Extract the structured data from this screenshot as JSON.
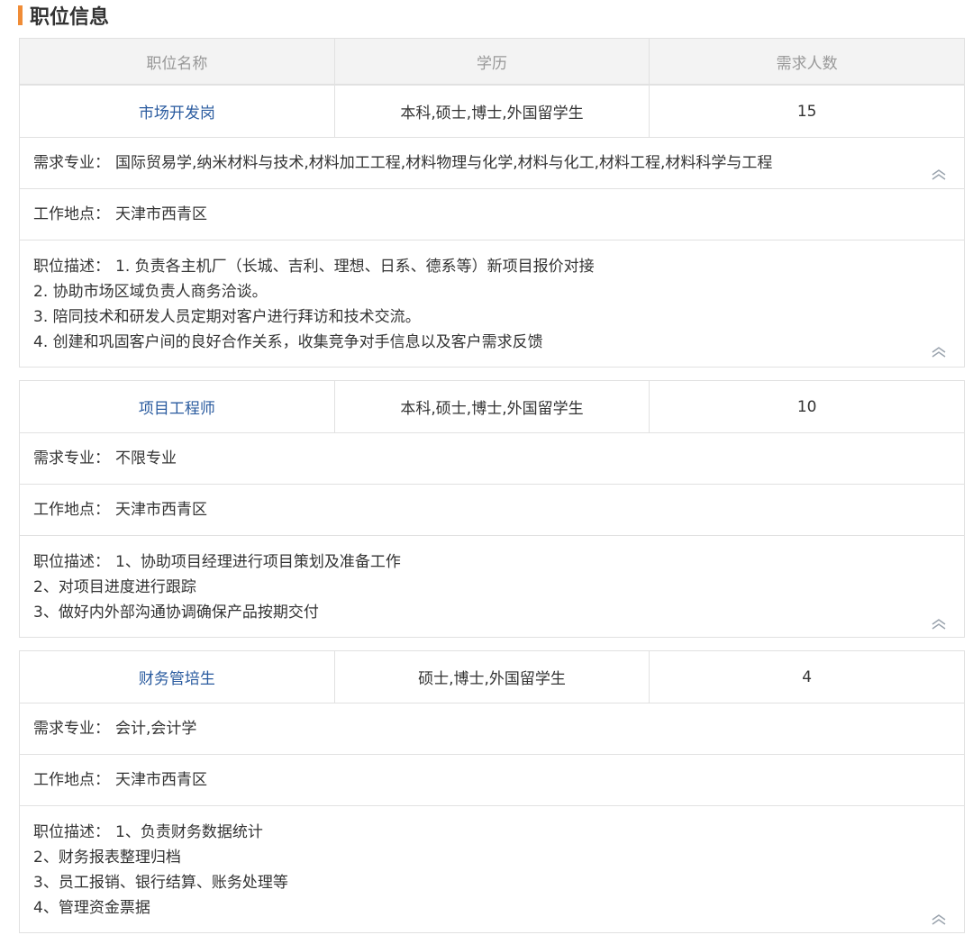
{
  "section": {
    "title": "职位信息"
  },
  "headers": [
    "职位名称",
    "学历",
    "需求人数"
  ],
  "labels": {
    "major": "需求专业：",
    "location": "工作地点：",
    "description": "职位描述："
  },
  "jobs": [
    {
      "name": "市场开发岗",
      "education": "本科,硕士,博士,外国留学生",
      "count": "15",
      "major": "国际贸易学,纳米材料与技术,材料加工工程,材料物理与化学,材料与化工,材料工程,材料科学与工程",
      "location": "天津市西青区",
      "description": [
        "1. 负责各主机厂（长城、吉利、理想、日系、德系等）新项目报价对接",
        "2. 协助市场区域负责人商务洽谈。",
        "3. 陪同技术和研发人员定期对客户进行拜访和技术交流。",
        "4. 创建和巩固客户间的良好合作关系，收集竞争对手信息以及客户需求反馈"
      ]
    },
    {
      "name": "项目工程师",
      "education": "本科,硕士,博士,外国留学生",
      "count": "10",
      "major": "不限专业",
      "location": "天津市西青区",
      "description": [
        "1、协助项目经理进行项目策划及准备工作",
        "2、对项目进度进行跟踪",
        "3、做好内外部沟通协调确保产品按期交付"
      ]
    },
    {
      "name": "财务管培生",
      "education": "硕士,博士,外国留学生",
      "count": "4",
      "major": "会计,会计学",
      "location": "天津市西青区",
      "description": [
        "1、负责财务数据统计",
        "2、财务报表整理归档",
        "3、员工报销、银行结算、账务处理等",
        "4、管理资金票据"
      ]
    }
  ]
}
